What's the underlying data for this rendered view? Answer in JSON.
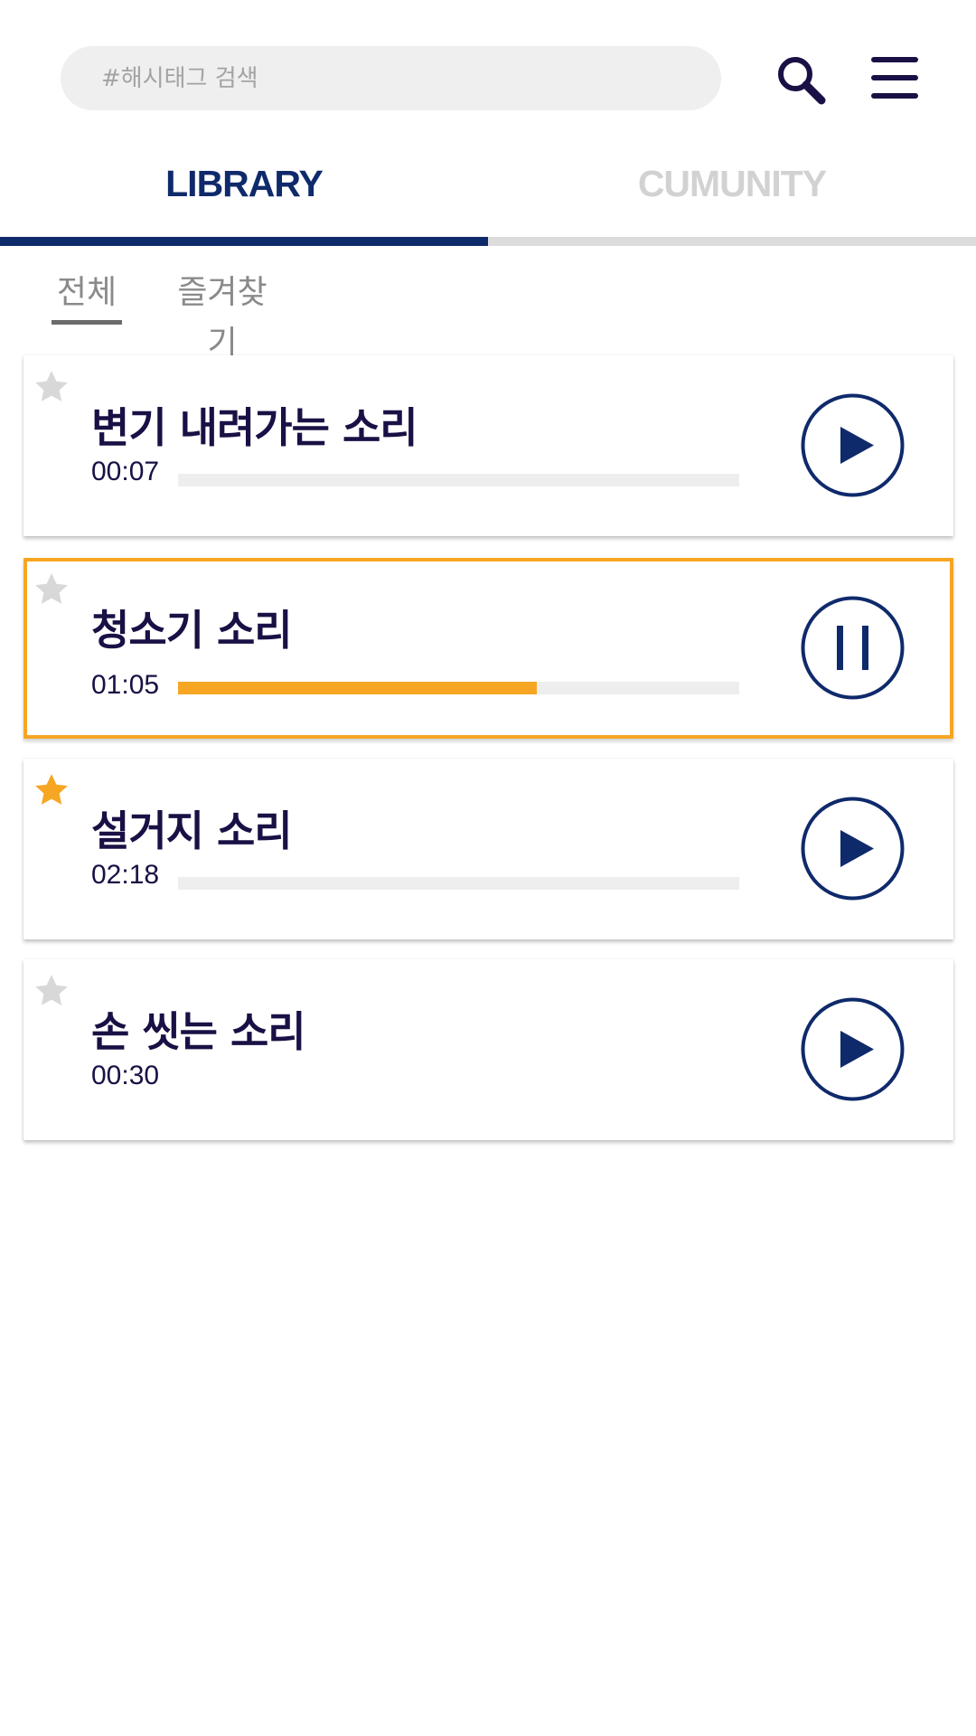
{
  "search": {
    "placeholder": "#해시태그 검색",
    "value": ""
  },
  "header": {
    "search_icon": "magnifier-icon",
    "menu_icon": "hamburger-menu-icon"
  },
  "tabs": [
    {
      "label": "LIBRARY",
      "selected": true
    },
    {
      "label": "CUMUNITY",
      "selected": false
    }
  ],
  "subtabs": [
    {
      "label": "전체",
      "selected": true
    },
    {
      "label": "즐겨찾기",
      "selected": false
    }
  ],
  "sounds": [
    {
      "title": "변기 내려가는 소리",
      "duration": "00:07",
      "favorite": false,
      "playing": false,
      "progress": 0,
      "show_progress": true
    },
    {
      "title": "청소기 소리",
      "duration": "01:05",
      "favorite": false,
      "playing": true,
      "progress": 0.64,
      "show_progress": true
    },
    {
      "title": "설거지 소리",
      "duration": "02:18",
      "favorite": true,
      "playing": false,
      "progress": 0,
      "show_progress": true
    },
    {
      "title": "손 씻는 소리",
      "duration": "00:30",
      "favorite": false,
      "playing": false,
      "progress": 0,
      "show_progress": false
    }
  ],
  "colors": {
    "navy": "#0f2a6b",
    "title_text": "#1a1045",
    "accent": "#f6a623",
    "inactive": "#d2d2d2",
    "star_off": "#d8d8d8",
    "track": "#eeeeee"
  }
}
